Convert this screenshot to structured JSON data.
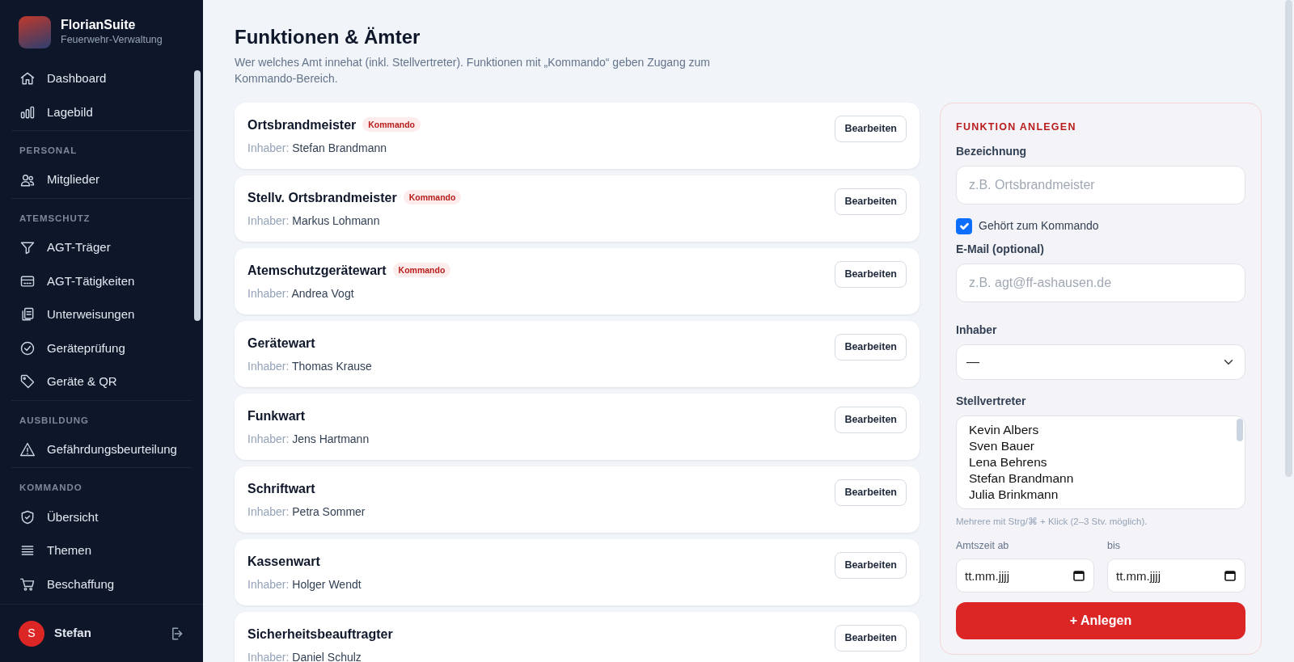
{
  "app": {
    "name": "FlorianSuite",
    "subtitle": "Feuerwehr-Verwaltung"
  },
  "sidebar": {
    "sections": [
      {
        "items": [
          {
            "label": "Dashboard",
            "selected": false
          },
          {
            "label": "Lagebild",
            "selected": false
          }
        ]
      },
      {
        "heading": "PERSONAL",
        "items": [
          {
            "label": "Mitglieder",
            "selected": false
          }
        ]
      },
      {
        "heading": "ATEMSCHUTZ",
        "items": [
          {
            "label": "AGT-Träger",
            "selected": false
          },
          {
            "label": "AGT-Tätigkeiten",
            "selected": false
          },
          {
            "label": "Unterweisungen",
            "selected": false
          },
          {
            "label": "Geräteprüfung",
            "selected": false
          },
          {
            "label": "Geräte & QR",
            "selected": false
          }
        ]
      },
      {
        "heading": "AUSBILDUNG",
        "items": [
          {
            "label": "Gefährdungsbeurteilung",
            "selected": false
          }
        ]
      },
      {
        "heading": "KOMMANDO",
        "items": [
          {
            "label": "Übersicht",
            "selected": false
          },
          {
            "label": "Themen",
            "selected": false
          },
          {
            "label": "Beschaffung",
            "selected": false
          }
        ]
      }
    ],
    "user": {
      "initial": "S",
      "name": "Stefan"
    }
  },
  "page": {
    "title": "Funktionen & Ämter",
    "description": "Wer welches Amt innehat (inkl. Stellvertreter). Funktionen mit „Kommando“ geben Zugang zum Kommando-Bereich."
  },
  "functions": [
    {
      "name": "Ortsbrandmeister",
      "holder_label": "Inhaber:",
      "holder": "Stefan Brandmann",
      "badge": "Kommando",
      "button": "Bearbeiten"
    },
    {
      "name": "Stellv. Ortsbrandmeister",
      "holder_label": "Inhaber:",
      "holder": "Markus Lohmann",
      "badge": "Kommando",
      "button": "Bearbeiten"
    },
    {
      "name": "Atemschutzgerätewart",
      "holder_label": "Inhaber:",
      "holder": "Andrea Vogt",
      "badge": "Kommando",
      "button": "Bearbeiten"
    },
    {
      "name": "Gerätewart",
      "holder_label": "Inhaber:",
      "holder": "Thomas Krause",
      "button": "Bearbeiten"
    },
    {
      "name": "Funkwart",
      "holder_label": "Inhaber:",
      "holder": "Jens Hartmann",
      "button": "Bearbeiten"
    },
    {
      "name": "Schriftwart",
      "holder_label": "Inhaber:",
      "holder": "Petra Sommer",
      "button": "Bearbeiten"
    },
    {
      "name": "Kassenwart",
      "holder_label": "Inhaber:",
      "holder": "Holger Wendt",
      "button": "Bearbeiten"
    },
    {
      "name": "Sicherheitsbeauftragter",
      "holder_label": "Inhaber:",
      "holder": "Daniel Schulz",
      "button": "Bearbeiten"
    }
  ],
  "form": {
    "title": "FUNKTION ANLEGEN",
    "name_label": "Bezeichnung",
    "name_placeholder": "z.B. Ortsbrandmeister",
    "kommando_label": "Gehört zum Kommando",
    "kommando_checked": true,
    "email_label": "E-Mail (optional)",
    "email_placeholder": "z.B. agt@ff-ashausen.de",
    "holder_label": "Inhaber",
    "holder_value": "—",
    "deputies_label": "Stellvertreter",
    "deputies": [
      {
        "name": "Kevin Albers",
        "selected": false
      },
      {
        "name": "Sven Bauer",
        "selected": false
      },
      {
        "name": "Lena Behrens",
        "selected": false
      },
      {
        "name": "Stefan Brandmann",
        "selected": false
      },
      {
        "name": "Julia Brinkmann",
        "selected": false
      }
    ],
    "deputies_hint": "Mehrere mit Strg/⌘ + Klick (2–3 Stv. möglich).",
    "from_label": "Amtszeit ab",
    "from_placeholder": "tt.mm.jjjj",
    "to_label": "bis",
    "to_placeholder": "tt.mm.jjjj",
    "submit": "+ Anlegen"
  }
}
